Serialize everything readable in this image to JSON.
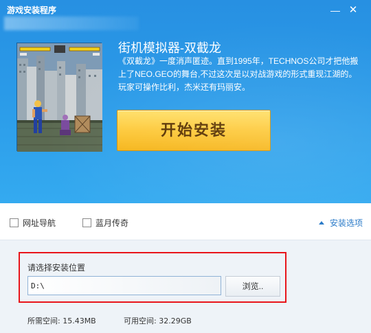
{
  "window": {
    "title": "游戏安装程序",
    "minimize_glyph": "—",
    "close_glyph": "✕"
  },
  "header": {
    "game_art_label": "街机模拟器-双截龙 screenshot",
    "game_title": "街机模拟器-双截龙",
    "description": "《双截龙》一度消声匿迹。直到1995年，TECHNOS公司才把他搬上了NEO.GEO的舞台,不过这次是以对战游戏的形式重现江湖的。玩家可操作比利，杰米还有玛丽安。",
    "install_button": "开始安装"
  },
  "options": {
    "items": [
      {
        "label": "网址导航",
        "checked": false
      },
      {
        "label": "蓝月传奇",
        "checked": false
      }
    ],
    "install_options_label": "安装选项"
  },
  "location": {
    "label": "请选择安装位置",
    "path_value": "D:\\",
    "browse_label": "浏览.."
  },
  "space": {
    "required": "所需空间: 15.43MB",
    "free": "可用空间: 32.29GB"
  },
  "colors": {
    "header_blue": "#2a9ae8",
    "button_yellow": "#fdc93a",
    "highlight_red": "#e8141a",
    "link_blue": "#2b7bc8"
  }
}
